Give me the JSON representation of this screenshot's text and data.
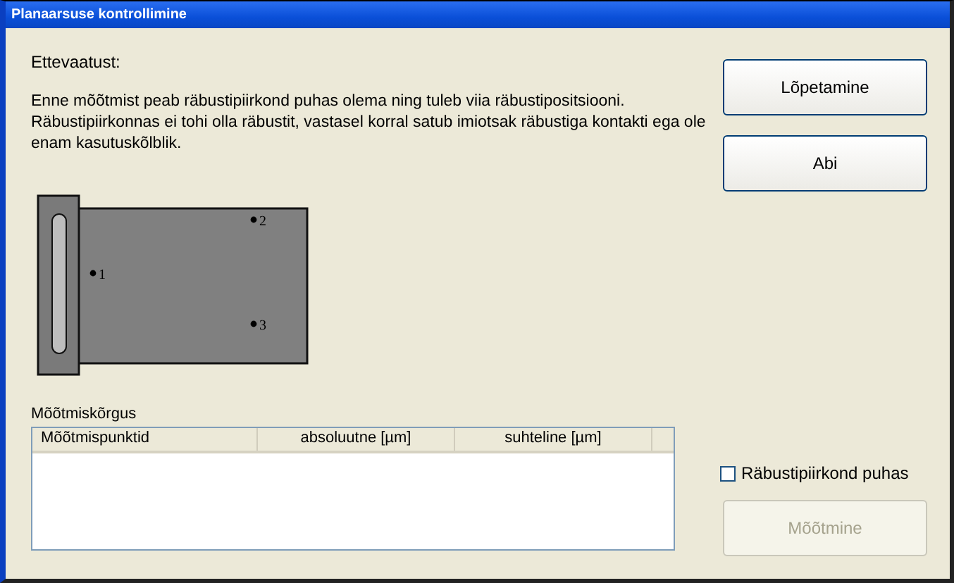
{
  "window": {
    "title": "Planaarsuse kontrollimine"
  },
  "warning": {
    "heading": "Ettevaatust:",
    "text": "Enne mõõtmist peab räbustipiirkond puhas olema ning tuleb viia räbustipositsiooni. Räbustipiirkonnas ei tohi olla räbustit, vastasel korral satub imiotsak räbustiga kontakti ega ole enam kasutuskõlblik."
  },
  "buttons": [
    {
      "label": "Lõpetamine",
      "disabled": false
    },
    {
      "label": "Abi",
      "disabled": false
    }
  ],
  "diagram": {
    "points": [
      {
        "label": "1"
      },
      {
        "label": "2"
      },
      {
        "label": "3"
      }
    ]
  },
  "table": {
    "label": "Mõõtmiskõrgus",
    "columns": [
      "Mõõtmispunktid",
      "absoluutne [µm]",
      "suhteline [µm]"
    ]
  },
  "checkbox": {
    "label": "Räbustipiirkond puhas",
    "checked": false
  },
  "measure_button": {
    "label": "Mõõtmine",
    "disabled": true
  }
}
